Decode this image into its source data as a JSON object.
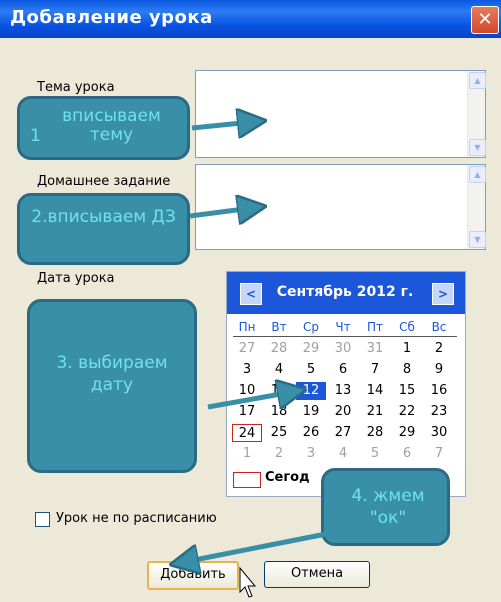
{
  "window": {
    "title": "Добавление урока",
    "close_glyph": "✕"
  },
  "fields": {
    "topic_label": "Тема урока",
    "homework_label": "Домашнее задание",
    "date_label": "Дата урока",
    "topic_value": "",
    "homework_value": ""
  },
  "calendar": {
    "month_title": "Сентябрь 2012 г.",
    "prev_glyph": "<",
    "next_glyph": ">",
    "weekdays": [
      "Пн",
      "Вт",
      "Ср",
      "Чт",
      "Пт",
      "Сб",
      "Вс"
    ],
    "weeks": [
      [
        "27",
        "28",
        "29",
        "30",
        "31",
        "1",
        "2"
      ],
      [
        "3",
        "4",
        "5",
        "6",
        "7",
        "8",
        "9"
      ],
      [
        "10",
        "11",
        "12",
        "13",
        "14",
        "15",
        "16"
      ],
      [
        "17",
        "18",
        "19",
        "20",
        "21",
        "22",
        "23"
      ],
      [
        "24",
        "25",
        "26",
        "27",
        "28",
        "29",
        "30"
      ],
      [
        "1",
        "2",
        "3",
        "4",
        "5",
        "6",
        "7"
      ]
    ],
    "selected_day": "12",
    "today_day": "24",
    "today_label": "Сегод"
  },
  "checkbox": {
    "label": "Урок не по расписанию",
    "checked": false
  },
  "buttons": {
    "add": "Добавить",
    "cancel": "Отмена"
  },
  "callouts": {
    "c1": "вписываем тему",
    "c1_num": "1",
    "c2": "2.вписываем ДЗ",
    "c3": "3. выбираем дату",
    "c4": "4. жмем \"ок\""
  },
  "colors": {
    "title_bar": "#0a58e0",
    "callout": "#3a8fa8",
    "callout_text": "#6fe0f0",
    "selected": "#1c56d9"
  }
}
